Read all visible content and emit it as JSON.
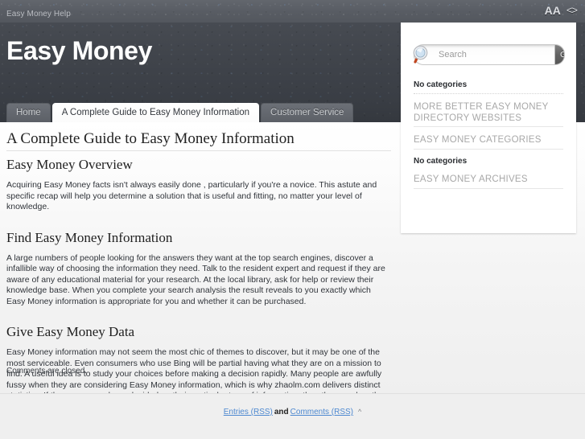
{
  "topbar": {
    "help_link": "Easy Money Help",
    "tools": [
      {
        "name": "font-size-icon",
        "glyph_big": "A",
        "glyph_small": "A"
      },
      {
        "name": "code-view-icon",
        "glyph": "<>"
      }
    ]
  },
  "masthead": {
    "site_title": "Easy Money"
  },
  "nav": {
    "tabs": [
      {
        "label": "Home",
        "active": false
      },
      {
        "label": "A Complete Guide to Easy Money Information",
        "active": true
      },
      {
        "label": "Customer Service",
        "active": false
      }
    ]
  },
  "content": {
    "entry_title": "A Complete Guide to Easy Money Information",
    "sections": [
      {
        "heading": "Easy Money Overview",
        "paragraph": "Acquiring Easy Money facts isn't always easily done , particularly if you're a novice. This astute and specific recap will help you determine a solution that is useful and fitting, no matter your level of knowledge."
      },
      {
        "heading": "Find Easy Money Information",
        "paragraph": "A large numbers of people looking for the answers they want at the top search engines, discover a infallible way of choosing the information they need. Talk to the resident expert and request if they are aware of any educational material for your research. At the local library, ask for help or review their knowledge base. When you complete your search analysis the result reveals to you exactly which Easy Money information is appropriate for you and whether it can be purchased."
      },
      {
        "heading": "Give Easy Money Data",
        "paragraph": "Easy Money information may not seem the most chic of themes to discover, but it may be one of the most serviceable. Even consumers who use Bing will be partial having what they are on a mission to find. A useful idea is to study your choices before making a decision rapidly. Many people are awfully fussy when they are considering Easy Money information, which is why zhaolm.com delivers distinct statistics. If the consumers have decided on their particular type of information, then they can buy the affiliated products or services."
      }
    ],
    "comments_closed": "Comments are closed."
  },
  "sidebar": {
    "search": {
      "placeholder": "Search",
      "value": "",
      "go_label": "Go",
      "icon": "magnifier-icon"
    },
    "widgets": [
      {
        "type": "note",
        "text": "No categories"
      },
      {
        "type": "title",
        "text": "MORE BETTER EASY MONEY DIRECTORY WEBSITES"
      },
      {
        "type": "title",
        "text": "EASY MONEY CATEGORIES"
      },
      {
        "type": "note",
        "text": "No categories"
      },
      {
        "type": "title",
        "text": "EASY MONEY ARCHIVES"
      }
    ]
  },
  "footer": {
    "entries_rss": "Entries (RSS)",
    "and": "and",
    "comments_rss": "Comments (RSS)",
    "back_to_top": "^"
  },
  "colors": {
    "topbar": "#585c63",
    "masthead": "#41454c",
    "nav": "#34383e",
    "canvas": "#f4f4f4",
    "link": "#4d88d0",
    "widget_title": "#a8a8a8"
  }
}
